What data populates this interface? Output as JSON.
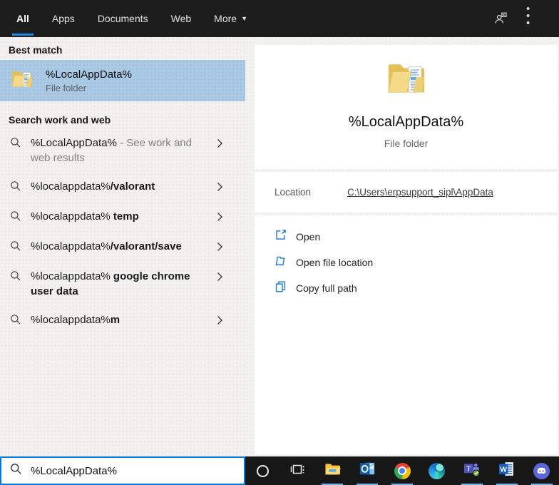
{
  "header": {
    "tabs": [
      {
        "label": "All",
        "active": true
      },
      {
        "label": "Apps",
        "active": false
      },
      {
        "label": "Documents",
        "active": false
      },
      {
        "label": "Web",
        "active": false
      },
      {
        "label": "More",
        "active": false,
        "has_dropdown": true
      }
    ],
    "icons": [
      "account-icon",
      "more-options-icon"
    ]
  },
  "left": {
    "best_match_heading": "Best match",
    "best_match": {
      "title": "%LocalAppData%",
      "subtitle": "File folder",
      "icon": "folder-icon"
    },
    "search_heading": "Search work and web",
    "suggestions": [
      {
        "normal": "%LocalAppData%",
        "bold": "",
        "gray": " - See work and web results"
      },
      {
        "normal": "%localappdata%",
        "bold": "/valorant",
        "gray": ""
      },
      {
        "normal": "%localappdata% ",
        "bold": "temp",
        "gray": ""
      },
      {
        "normal": "%localappdata%",
        "bold": "/valorant/save",
        "gray": ""
      },
      {
        "normal": "%localappdata% ",
        "bold": "google chrome user data",
        "gray": ""
      },
      {
        "normal": "%localappdata%",
        "bold": "m",
        "gray": ""
      }
    ]
  },
  "preview": {
    "icon": "folder-icon",
    "title": "%LocalAppData%",
    "subtitle": "File folder",
    "location_label": "Location",
    "location_value": "C:\\Users\\erpsupport_sipl\\AppData",
    "actions": [
      {
        "icon": "open-icon",
        "label": "Open"
      },
      {
        "icon": "open-file-location-icon",
        "label": "Open file location"
      },
      {
        "icon": "copy-icon",
        "label": "Copy full path"
      }
    ]
  },
  "search_bar": {
    "value": "%LocalAppData%",
    "icon": "search-icon"
  },
  "taskbar": {
    "items": [
      {
        "name": "cortana",
        "running": false
      },
      {
        "name": "task-view",
        "running": false
      },
      {
        "name": "file-explorer",
        "running": true
      },
      {
        "name": "outlook",
        "running": true
      },
      {
        "name": "chrome",
        "running": true
      },
      {
        "name": "edge",
        "running": false
      },
      {
        "name": "teams",
        "running": true
      },
      {
        "name": "word",
        "running": true
      },
      {
        "name": "discord",
        "running": true
      }
    ]
  },
  "colors": {
    "accent": "#0078d7",
    "tab_underline": "#1e87e5",
    "best_match_highlight": "#a9c9e4",
    "header_bg": "#1d1d1d",
    "taskbar_bg": "#171717",
    "action_icon_blue": "#1a77d2",
    "running_indicator": "#6db3e8"
  }
}
